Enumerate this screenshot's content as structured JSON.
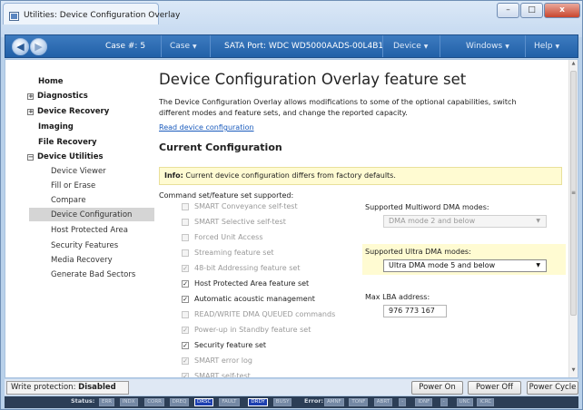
{
  "window": {
    "title": "Utilities: Device Configuration Overlay",
    "controls": {
      "minimize": "–",
      "maximize": "□",
      "close": "x"
    }
  },
  "navbar": {
    "case_label": "Case #:",
    "case_number": "5",
    "case_menu": "Case",
    "sata_port": "SATA Port: WDC WD5000AADS-00L4B1",
    "device_menu": "Device",
    "windows_menu": "Windows",
    "help_menu": "Help"
  },
  "sidebar": {
    "items": [
      {
        "label": "Home"
      },
      {
        "label": "Diagnostics",
        "expander": "+"
      },
      {
        "label": "Device Recovery",
        "expander": "+"
      },
      {
        "label": "Imaging"
      },
      {
        "label": "File Recovery"
      },
      {
        "label": "Device Utilities",
        "expander": "−"
      }
    ],
    "subitems": [
      {
        "label": "Device Viewer"
      },
      {
        "label": "Fill or Erase"
      },
      {
        "label": "Compare"
      },
      {
        "label": "Device Configuration"
      },
      {
        "label": "Host Protected Area"
      },
      {
        "label": "Security Features"
      },
      {
        "label": "Media Recovery"
      },
      {
        "label": "Generate Bad Sectors"
      }
    ]
  },
  "main": {
    "title": "Device Configuration Overlay feature set",
    "description": "The Device Configuration Overlay allows modifications to some of the optional capabilities, switch different modes and feature sets, and change the reported capacity.",
    "read_link": "Read device configuration",
    "section_title": "Current Configuration",
    "info_label": "Info:",
    "info_text": " Current device configuration differs from factory defaults.",
    "cmd_label": "Command set/feature set supported:",
    "features": [
      {
        "label": "SMART Conveyance self-test",
        "checked": false,
        "enabled": false
      },
      {
        "label": "SMART Selective self-test",
        "checked": false,
        "enabled": false
      },
      {
        "label": "Forced Unit Access",
        "checked": false,
        "enabled": false
      },
      {
        "label": "Streaming feature set",
        "checked": false,
        "enabled": false
      },
      {
        "label": "48-bit Addressing feature set",
        "checked": true,
        "enabled": false
      },
      {
        "label": "Host Protected Area feature set",
        "checked": true,
        "enabled": true
      },
      {
        "label": "Automatic acoustic management",
        "checked": true,
        "enabled": true
      },
      {
        "label": "READ/WRITE DMA QUEUED commands",
        "checked": false,
        "enabled": false
      },
      {
        "label": "Power-up in Standby feature set",
        "checked": true,
        "enabled": false
      },
      {
        "label": "Security feature set",
        "checked": true,
        "enabled": true
      },
      {
        "label": "SMART error log",
        "checked": true,
        "enabled": false
      },
      {
        "label": "SMART self-test",
        "checked": true,
        "enabled": false
      }
    ],
    "multiword_label": "Supported Multiword DMA modes:",
    "multiword_value": "DMA mode 2 and below",
    "udma_label": "Supported Ultra DMA modes:",
    "udma_value": "Ultra DMA mode 5 and below",
    "max_lba_label": "Max LBA address:",
    "max_lba_value": "976 773 167"
  },
  "bottom": {
    "write_protection_label": "Write protection:",
    "write_protection_value": "Disabled",
    "power_on": "Power On",
    "power_off": "Power Off",
    "power_cycle": "Power Cycle"
  },
  "status": {
    "status_label": "Status:",
    "status_regs": [
      {
        "label": "ERR",
        "on": false
      },
      {
        "label": "INDX",
        "on": false
      },
      {
        "label": "CORR",
        "on": false
      },
      {
        "label": "DREQ",
        "on": false
      },
      {
        "label": "DRSC",
        "on": true
      },
      {
        "label": "FAULT",
        "on": false
      },
      {
        "label": "DRDY",
        "on": true
      },
      {
        "label": "BUSY",
        "on": false
      }
    ],
    "error_label": "Error:",
    "error_regs": [
      {
        "label": "AMNF",
        "on": false
      },
      {
        "label": "TONF",
        "on": false
      },
      {
        "label": "ABRT",
        "on": false
      },
      {
        "label": "-",
        "on": false
      },
      {
        "label": "IDNF",
        "on": false
      },
      {
        "label": "-",
        "on": false
      },
      {
        "label": "UNC",
        "on": false
      },
      {
        "label": "ICRC",
        "on": false
      }
    ]
  },
  "colors": {
    "navbar": "#2c6bb3",
    "info_bg": "#fffbd2",
    "reg_on": "#1d3fb0",
    "link": "#1a5bbd"
  }
}
